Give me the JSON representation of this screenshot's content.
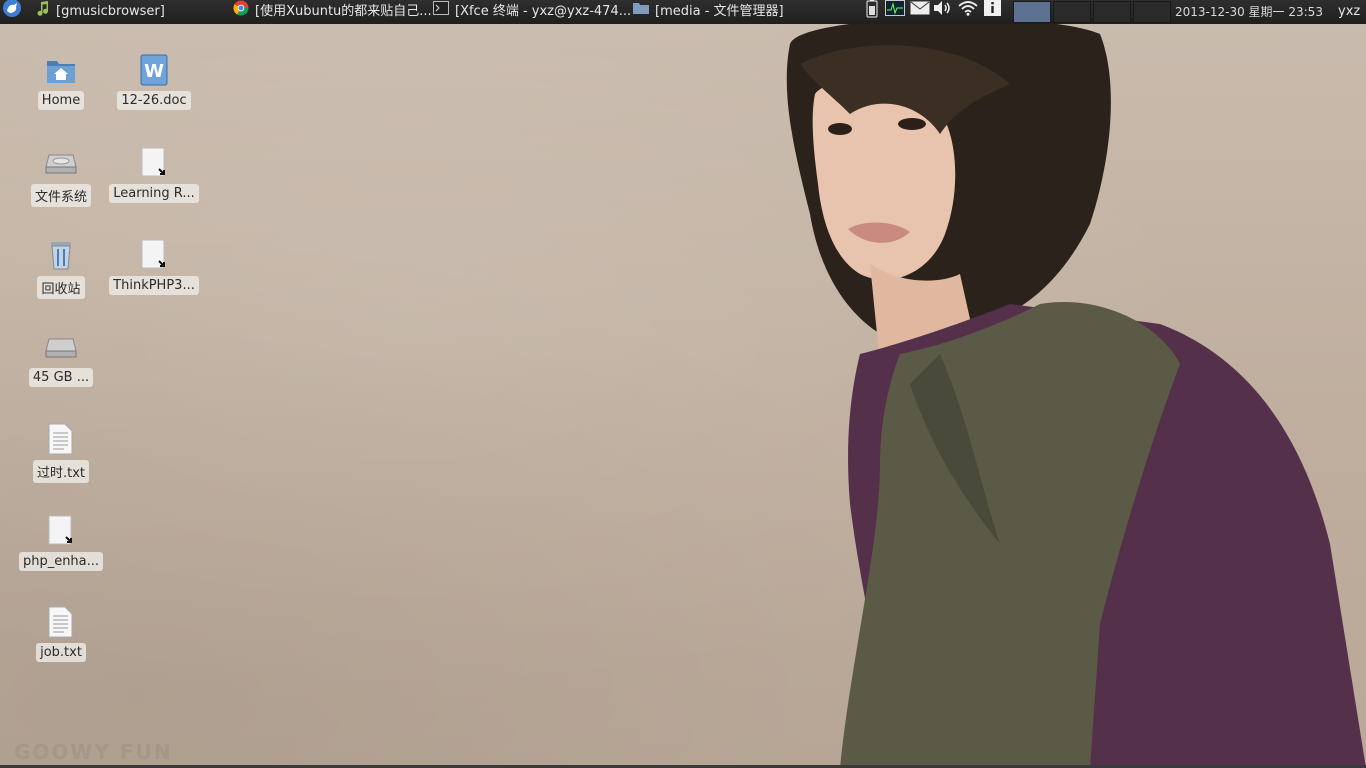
{
  "panel": {
    "tasks": [
      {
        "label": "[gmusicbrowser]",
        "icon": "music-note-icon"
      },
      {
        "label": "[使用Xubuntu的都来贴自己...",
        "icon": "chrome-icon"
      },
      {
        "label": "[Xfce 终端 - yxz@yxz-474...",
        "icon": "terminal-icon"
      },
      {
        "label": "[media - 文件管理器]",
        "icon": "folder-icon"
      }
    ],
    "tray_icons": [
      "battery-icon",
      "system-monitor-icon",
      "mail-icon",
      "volume-icon",
      "wifi-icon",
      "info-icon"
    ],
    "workspaces": 4,
    "active_workspace": 1,
    "clock": "2013-12-30 星期一 23:53",
    "user": "yxz"
  },
  "desktop": {
    "icons": [
      {
        "label": "Home",
        "icon": "home-folder-icon"
      },
      {
        "label": "12-26.doc",
        "icon": "word-doc-icon"
      },
      {
        "label": "文件系统",
        "icon": "drive-icon"
      },
      {
        "label": "Learning R...",
        "icon": "file-link-icon"
      },
      {
        "label": "回收站",
        "icon": "trash-icon"
      },
      {
        "label": "ThinkPHP3...",
        "icon": "file-link-icon"
      },
      {
        "label": "45 GB ...",
        "icon": "drive-icon"
      },
      {
        "label": "过时.txt",
        "icon": "text-file-icon"
      },
      {
        "label": "php_enha...",
        "icon": "file-link-icon"
      },
      {
        "label": "job.txt",
        "icon": "text-file-icon"
      }
    ]
  }
}
